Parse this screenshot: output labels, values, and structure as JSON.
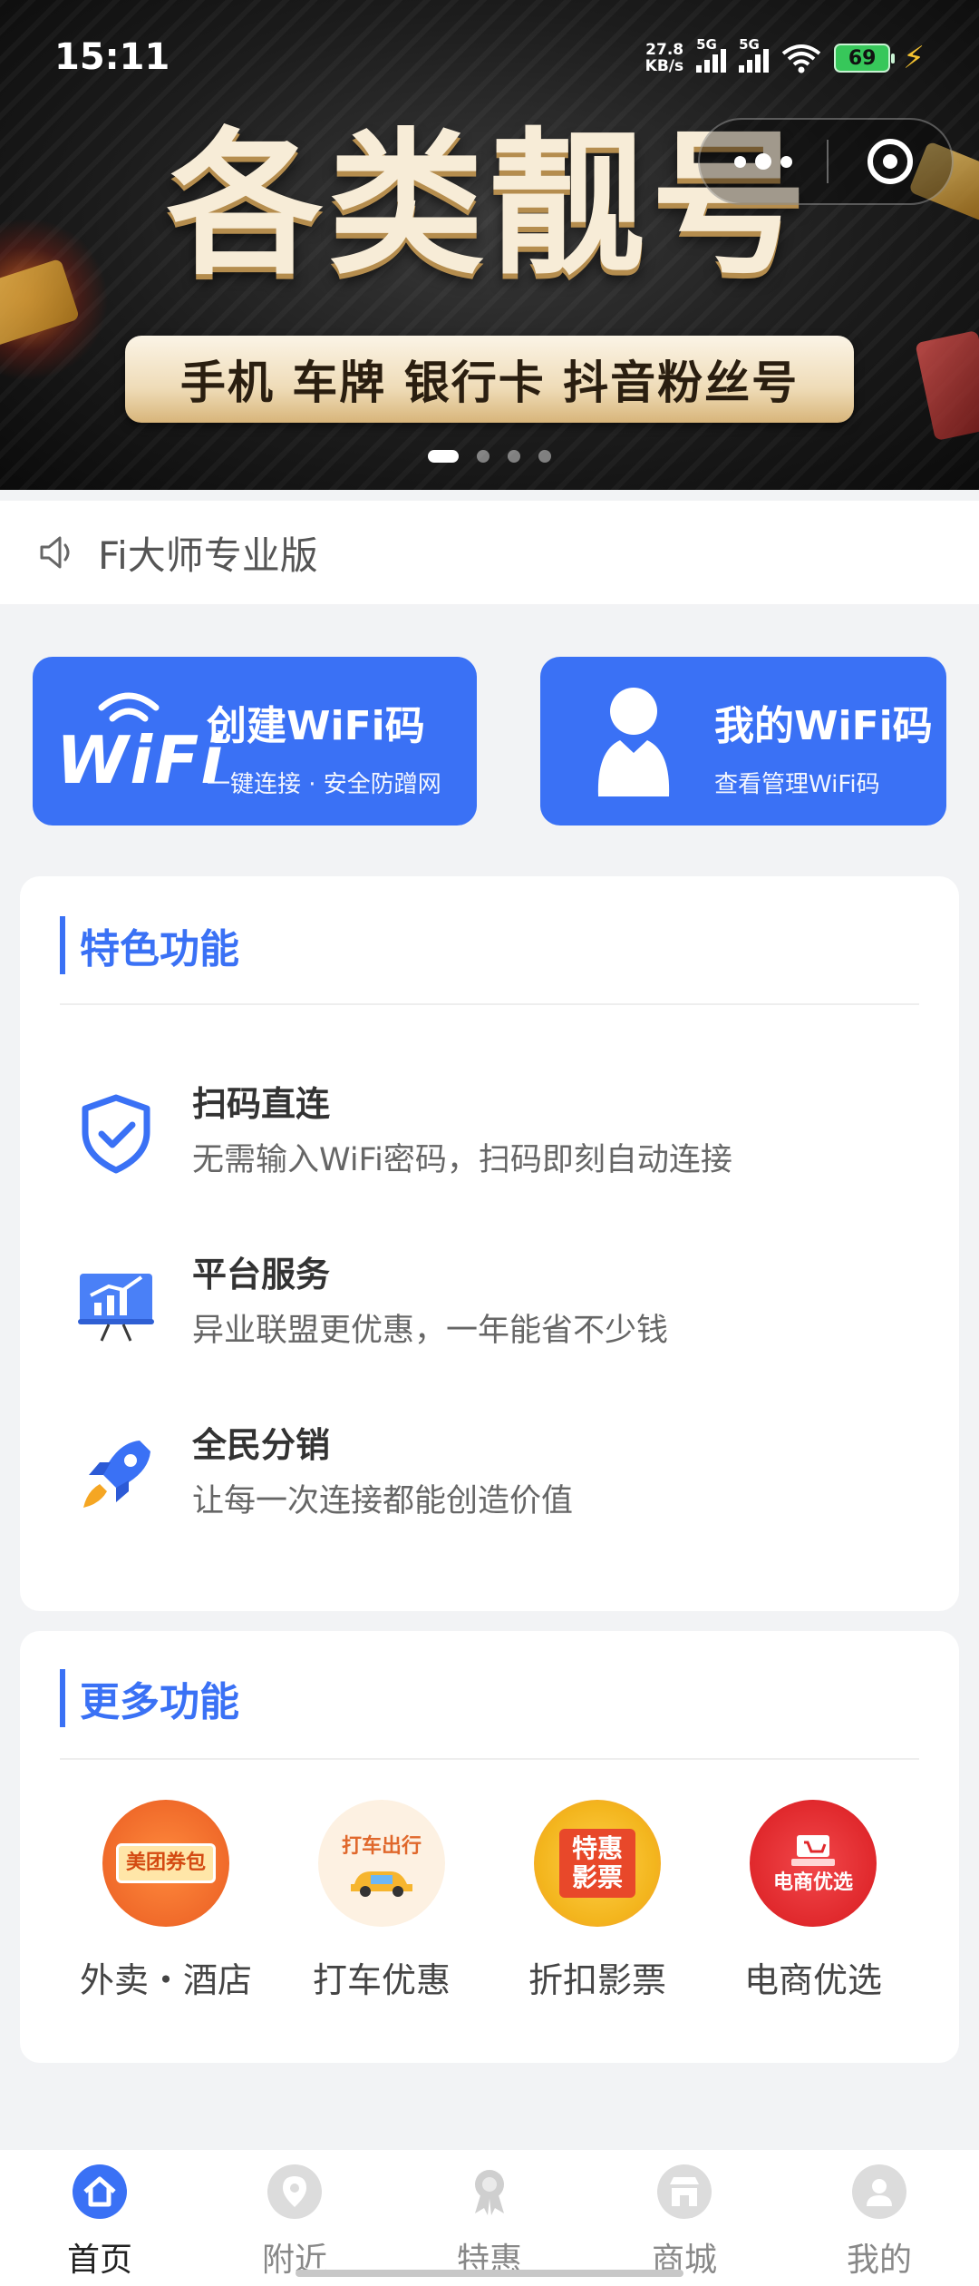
{
  "status_bar": {
    "time": "15:11",
    "net_speed_value": "27.8",
    "net_speed_unit": "KB/s",
    "sim1": "5G",
    "sim2": "5G",
    "battery": "69"
  },
  "banner": {
    "title": "各类靓号",
    "subtitle": "手机 车牌 银行卡 抖音粉丝号",
    "slide_index": 1,
    "slide_count": 4
  },
  "notice": {
    "text": "Fi大师专业版",
    "icon": "speaker-icon"
  },
  "actions": {
    "create": {
      "logo_text": "WiFi",
      "title": "创建WiFi码",
      "subtitle": "一键连接 · 安全防蹭网"
    },
    "mine": {
      "title": "我的WiFi码",
      "subtitle": "查看管理WiFi码"
    }
  },
  "features": {
    "title": "特色功能",
    "items": [
      {
        "name": "扫码直连",
        "desc": "无需输入WiFi密码，扫码即刻自动连接",
        "icon": "shield-check-icon"
      },
      {
        "name": "平台服务",
        "desc": "异业联盟更优惠，一年能省不少钱",
        "icon": "growth-board-icon"
      },
      {
        "name": "全民分销",
        "desc": "让每一次连接都能创造价值",
        "icon": "rocket-icon"
      }
    ]
  },
  "more": {
    "title": "更多功能",
    "items": [
      {
        "label": "外卖・酒店",
        "icon_text": "美团券包",
        "color": "#f06a2a"
      },
      {
        "label": "打车优惠",
        "icon_text": "打车出行",
        "color": "#f4b63b"
      },
      {
        "label": "折扣影票",
        "icon_text": "特惠影票",
        "color": "#f3b51d"
      },
      {
        "label": "电商优选",
        "icon_text": "电商优选",
        "color": "#e0282c"
      }
    ]
  },
  "tabbar": {
    "items": [
      {
        "label": "首页",
        "icon": "home-icon",
        "active": true
      },
      {
        "label": "附近",
        "icon": "location-pin-icon",
        "active": false
      },
      {
        "label": "特惠",
        "icon": "award-ribbon-icon",
        "active": false
      },
      {
        "label": "商城",
        "icon": "store-icon",
        "active": false
      },
      {
        "label": "我的",
        "icon": "user-icon",
        "active": false
      }
    ]
  },
  "colors": {
    "primary": "#3a71f5",
    "background": "#f2f3f5"
  }
}
